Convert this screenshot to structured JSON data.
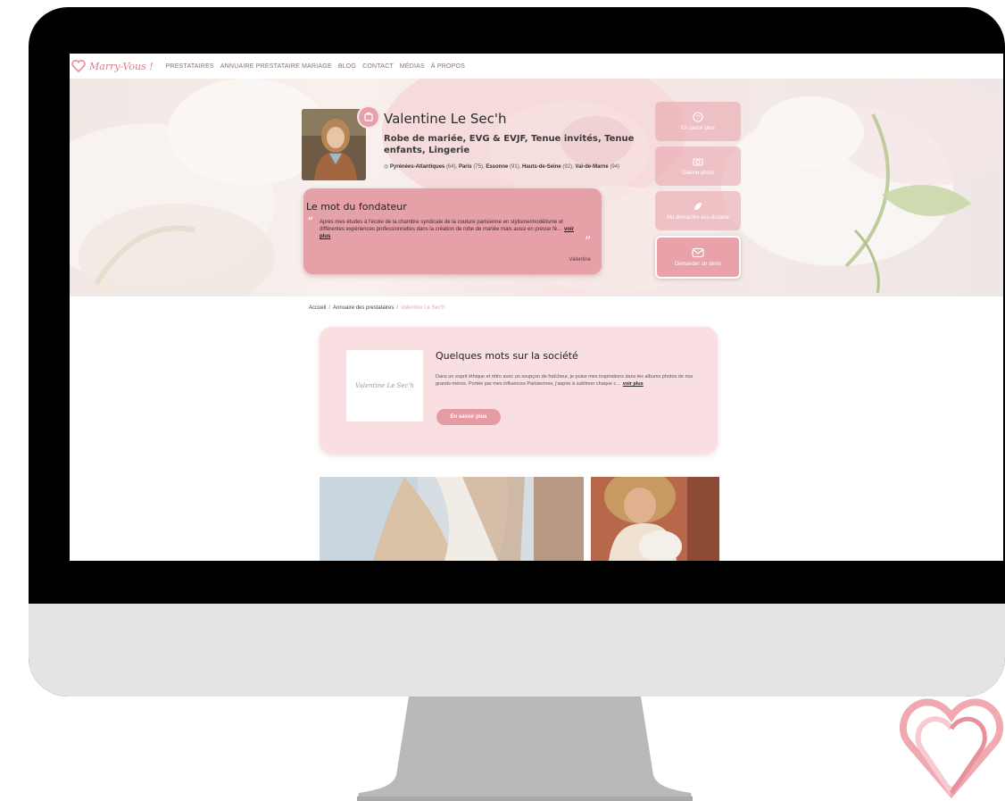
{
  "nav": {
    "logo_text": "Marry-Vous !",
    "links": [
      "PRESTATAIRES",
      "ANNUAIRE PRESTATAIRE MARIAGE",
      "BLOG",
      "CONTACT",
      "MÉDIAS",
      "À PROPOS"
    ]
  },
  "profile": {
    "name": "Valentine Le Sec'h",
    "categories": "Robe de mariée, EVG & EVJF, Tenue invités, Tenue enfants, Lingerie",
    "locations": [
      {
        "name": "Pyrénées-Atlantiques",
        "code": "(64)"
      },
      {
        "name": "Paris",
        "code": "(75)"
      },
      {
        "name": "Essonne",
        "code": "(91)"
      },
      {
        "name": "Hauts-de-Seine",
        "code": "(92)"
      },
      {
        "name": "Val-de-Marne",
        "code": "(94)"
      }
    ]
  },
  "founder": {
    "title": "Le mot du fondateur",
    "text": "Après mes études à l'école de la chambre syndicale de la couture parisienne en stylisme/modélisme et différentes expériences professionnelles dans la création de robe de mariée mais aussi en presse fé...",
    "read_more": "voir plus",
    "signature": "Valentine"
  },
  "actions": [
    {
      "label": "En savoir plus",
      "icon": "question-icon"
    },
    {
      "label": "Galerie photo",
      "icon": "camera-icon"
    },
    {
      "label": "Ma démarche éco-durable",
      "icon": "leaf-icon"
    },
    {
      "label": "Demander un devis",
      "icon": "mail-icon"
    }
  ],
  "breadcrumb": [
    "Accueil",
    "Annuaire des prestataires",
    "Valentine Le Sec'h"
  ],
  "company": {
    "logo_text": "Valentine Le Sec'h",
    "title": "Quelques mots sur la société",
    "text": "Dans un esprit éthique et rétro avec un soupçon de fraîcheur, je puise mes inspirations dans les albums photos de nos grands-mères. Portée par mes influences Parisiennes, j'aspire à sublimer chaque c...",
    "read_more": "voir plus",
    "button": "En savoir plus"
  },
  "colors": {
    "accent_pink": "#e69aa3",
    "soft_pink": "#f9dfe2",
    "monitor_bezel": "#000000",
    "monitor_chin": "#e4e4e6",
    "stand": "#b9b9bb"
  }
}
